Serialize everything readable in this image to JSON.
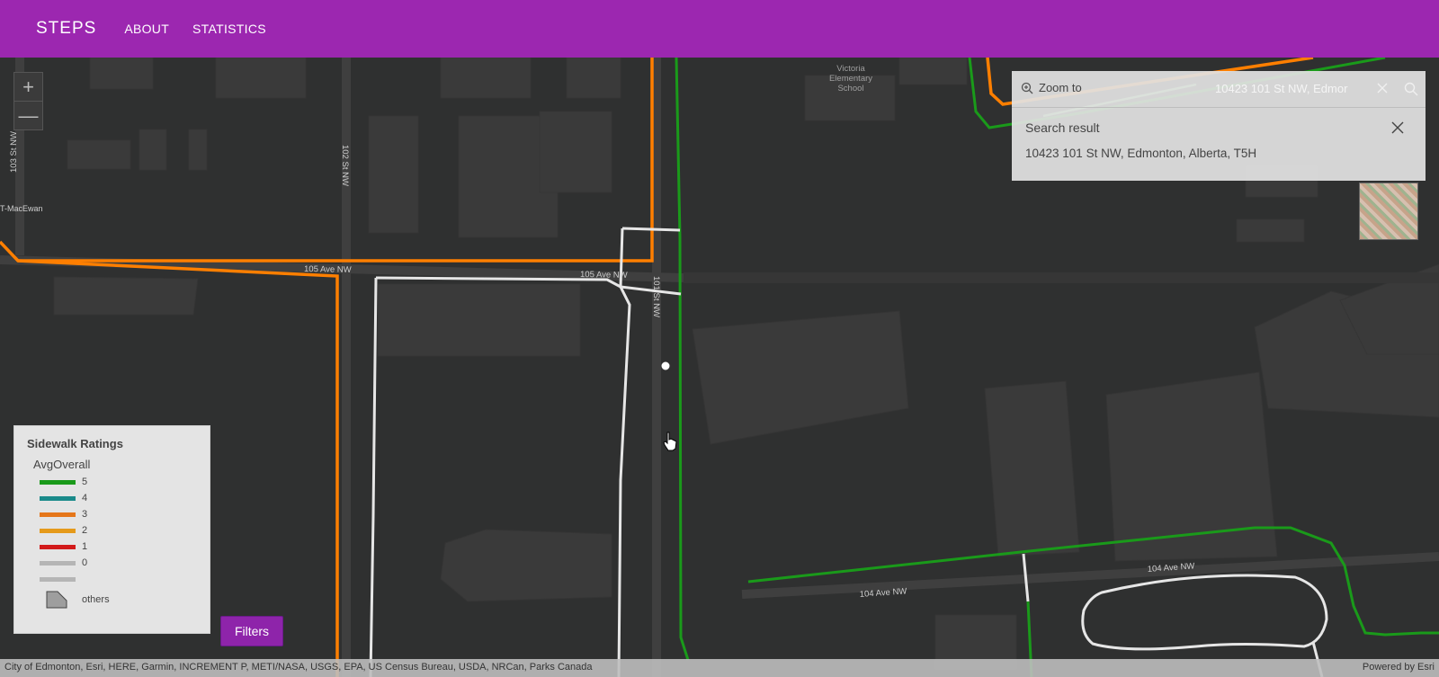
{
  "nav": {
    "brand": "STEPS",
    "links": [
      "ABOUT",
      "STATISTICS"
    ]
  },
  "map": {
    "zoom_in": "+",
    "zoom_out": "—",
    "street_labels": [
      "105 Ave NW",
      "105 Ave NW",
      "101 St NW",
      "102 St NW",
      "103 St NW",
      "104 Ave NW",
      "104 Ave NW"
    ],
    "place_labels": [
      "Victoria Elementary School",
      "T-MacEwan"
    ],
    "school_label_lines": [
      "Victoria",
      "Elementary",
      "School"
    ]
  },
  "search": {
    "zoom_to_label": "Zoom to",
    "value": "10423 101 St NW, Edmor",
    "result_title": "Search result",
    "result_text": "10423 101 St NW, Edmonton, Alberta, T5H"
  },
  "legend": {
    "title": "Sidewalk Ratings",
    "field": "AvgOverall",
    "items": [
      {
        "label": "5",
        "color": "#1a9a1a"
      },
      {
        "label": "4",
        "color": "#1a8a8a"
      },
      {
        "label": "3",
        "color": "#e5761a"
      },
      {
        "label": "2",
        "color": "#e59a1a"
      },
      {
        "label": "1",
        "color": "#d21a1a"
      },
      {
        "label": "0",
        "color": "#b5b5b5"
      },
      {
        "label": "",
        "color": "#b5b5b5"
      }
    ],
    "others_label": "others"
  },
  "filters_button": "Filters",
  "attribution": {
    "left": "City of Edmonton, Esri, HERE, Garmin, INCREMENT P, METI/NASA, USGS, EPA, US Census Bureau, USDA, NRCan, Parks Canada",
    "right": "Powered by Esri"
  },
  "colors": {
    "header": "#9c27b0",
    "route_green": "#1a9a1a",
    "route_orange": "#ff7f00",
    "route_white": "#e6e6e6"
  }
}
